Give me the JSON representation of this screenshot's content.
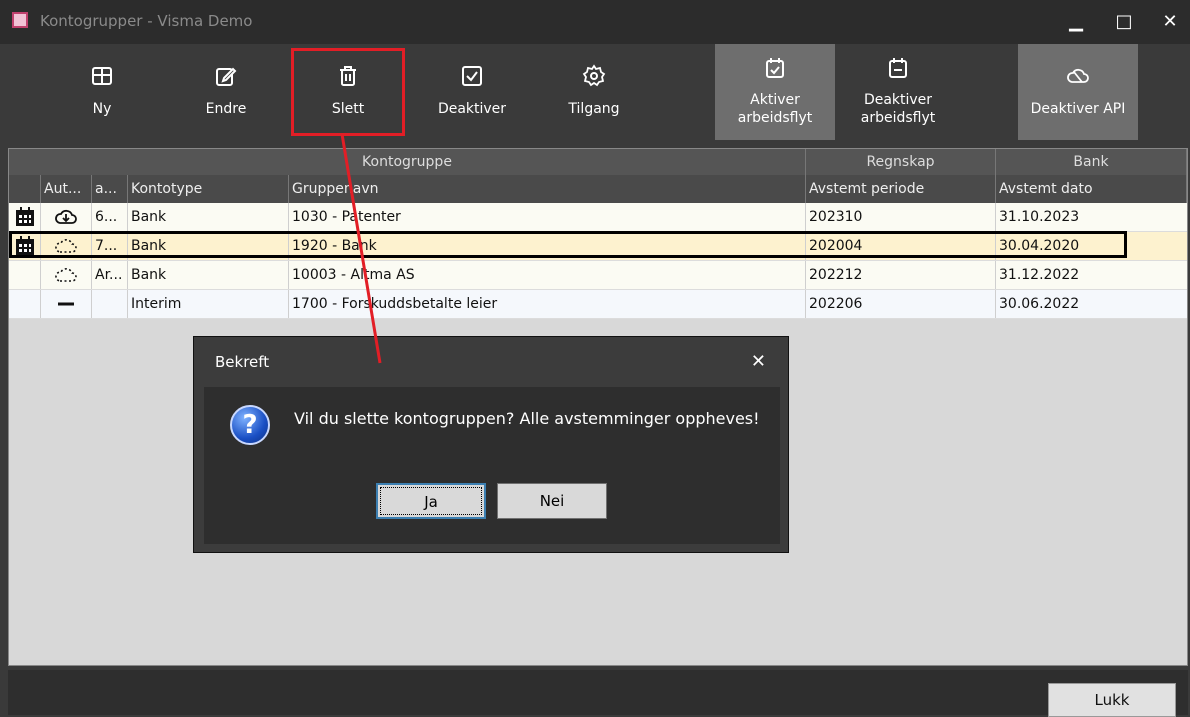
{
  "window": {
    "title": "Kontogrupper - Visma Demo",
    "minimize": "▁",
    "maximize": "□",
    "close": "✕"
  },
  "toolbar": {
    "ny": "Ny",
    "endre": "Endre",
    "slett": "Slett",
    "deaktiver": "Deaktiver",
    "tilgang": "Tilgang",
    "aktiver_arbeidsflyt_1": "Aktiver",
    "aktiver_arbeidsflyt_2": "arbeidsflyt",
    "deaktiver_arbeidsflyt_1": "Deaktiver",
    "deaktiver_arbeidsflyt_2": "arbeidsflyt",
    "deaktiver_api": "Deaktiver API"
  },
  "grid": {
    "groups": {
      "kontogruppe": "Kontogruppe",
      "regnskap": "Regnskap",
      "bank": "Bank"
    },
    "columns": [
      "Aut...",
      "a...",
      "Kontotype",
      "Gruppenavn",
      "Avstemt periode",
      "Avstemt dato"
    ],
    "rows": [
      {
        "flag": "calendar-icon",
        "auto": "cloud-download-icon",
        "a": "6...",
        "kontotype": "Bank",
        "gruppenavn": "1030 - Patenter",
        "periode": "202310",
        "dato": "31.10.2023"
      },
      {
        "flag": "calendar-icon",
        "auto": "dotted-cloud-icon",
        "a": "7...",
        "kontotype": "Bank",
        "gruppenavn": "1920 - Bank",
        "periode": "202004",
        "dato": "30.04.2020"
      },
      {
        "flag": "",
        "auto": "dotted-cloud-icon",
        "a": "Ar...",
        "kontotype": "Bank",
        "gruppenavn": "10003 - Altma AS",
        "periode": "202212",
        "dato": "31.12.2022"
      },
      {
        "flag": "",
        "auto": "dash-icon",
        "a": "",
        "kontotype": "Interim",
        "gruppenavn": "1700 - Forskuddsbetalte leier",
        "periode": "202206",
        "dato": "30.06.2022"
      }
    ]
  },
  "dialog": {
    "title": "Bekreft",
    "close": "✕",
    "message": "Vil du slette kontogruppen? Alle avstemminger oppheves!",
    "yes": "Ja",
    "no": "Nei"
  },
  "footer": {
    "close": "Lukk"
  },
  "colors": {
    "highlight": "#e21e26",
    "selected_row": "#fdf2cf",
    "toolbar_active": "#6e6e6e"
  }
}
